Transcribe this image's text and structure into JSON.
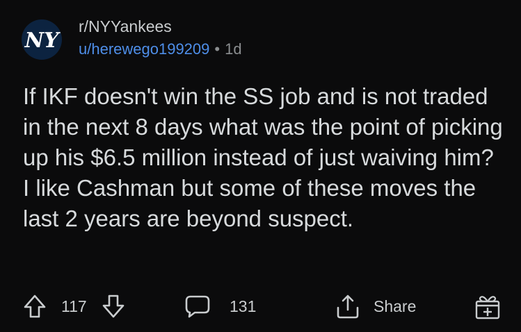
{
  "post": {
    "subreddit": "r/NYYankees",
    "username": "u/herewego199209",
    "separator": "•",
    "age": "1d",
    "title": "If IKF doesn't win the SS job and is not traded in the next 8 days what was the point of picking up his $6.5 million instead of just waiving him? I like Cashman but some of these moves the last 2 years are beyond suspect.",
    "avatar_icon": "yankees-logo-icon",
    "avatar_text": "NY"
  },
  "actions": {
    "upvote_icon": "upvote-arrow-icon",
    "vote_count": "117",
    "downvote_icon": "downvote-arrow-icon",
    "comment_icon": "comment-bubble-icon",
    "comment_count": "131",
    "share_icon": "share-icon",
    "share_label": "Share",
    "award_icon": "gift-award-icon"
  },
  "colors": {
    "background": "#0b0b0c",
    "text": "#d7dadc",
    "username": "#4e8ee8",
    "muted": "#8b8e90",
    "avatar_bg": "#0c2340"
  }
}
